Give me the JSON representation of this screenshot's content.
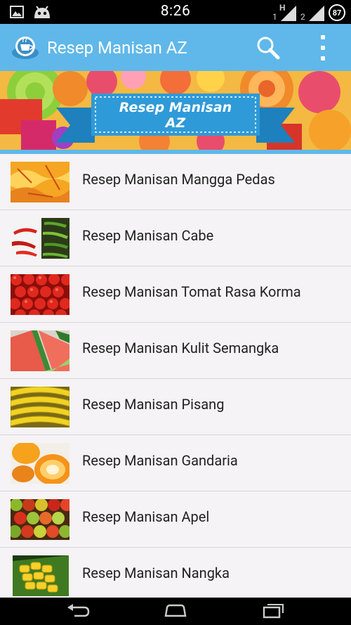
{
  "status_bar": {
    "time": "8:26",
    "sim1_label": "1",
    "sim1_network": "H",
    "sim2_label": "2",
    "battery": "87"
  },
  "app_bar": {
    "title": "Resep Manisan AZ"
  },
  "banner": {
    "line1": "Resep Manisan",
    "line2": "AZ"
  },
  "recipes": [
    {
      "label": "Resep Manisan Mangga Pedas",
      "thumb": "mango-thumbnail"
    },
    {
      "label": "Resep Manisan Cabe",
      "thumb": "chili-thumbnail"
    },
    {
      "label": "Resep Manisan Tomat Rasa Korma",
      "thumb": "tomato-thumbnail"
    },
    {
      "label": "Resep Manisan Kulit Semangka",
      "thumb": "watermelon-thumbnail"
    },
    {
      "label": "Resep Manisan Pisang",
      "thumb": "banana-thumbnail"
    },
    {
      "label": "Resep Manisan Gandaria",
      "thumb": "gandaria-thumbnail"
    },
    {
      "label": "Resep Manisan Apel",
      "thumb": "apple-thumbnail"
    },
    {
      "label": "Resep Manisan Nangka",
      "thumb": "jackfruit-thumbnail"
    }
  ],
  "colors": {
    "accent": "#5fb8e9",
    "status_bar": "#000000",
    "list_background": "#f5f3f5"
  }
}
